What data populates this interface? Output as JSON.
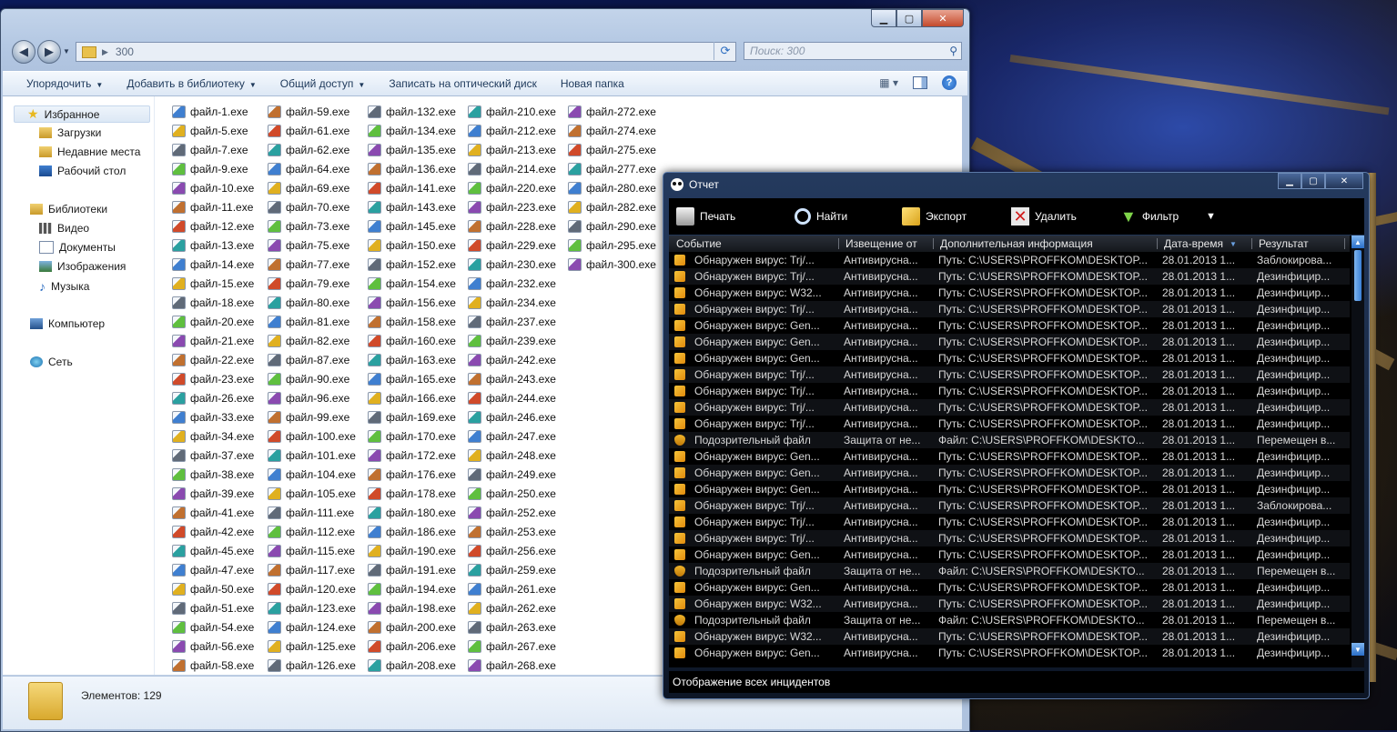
{
  "explorer": {
    "address_path": "300",
    "search_placeholder": "Поиск: 300",
    "toolbar": {
      "organize": "Упорядочить",
      "add_to_library": "Добавить в библиотеку",
      "share": "Общий доступ",
      "burn": "Записать на оптический диск",
      "new_folder": "Новая папка"
    },
    "nav": {
      "favorites": "Избранное",
      "downloads": "Загрузки",
      "recent": "Недавние места",
      "desktop": "Рабочий стол",
      "libraries": "Библиотеки",
      "video": "Видео",
      "documents": "Документы",
      "pictures": "Изображения",
      "music": "Музыка",
      "computer": "Компьютер",
      "network": "Сеть"
    },
    "columns": [
      [
        "файл-1.exe",
        "файл-5.exe",
        "файл-7.exe",
        "файл-9.exe",
        "файл-10.exe",
        "файл-11.exe",
        "файл-12.exe",
        "файл-13.exe",
        "файл-14.exe",
        "файл-15.exe",
        "файл-18.exe",
        "файл-20.exe",
        "файл-21.exe",
        "файл-22.exe",
        "файл-23.exe",
        "файл-26.exe",
        "файл-33.exe",
        "файл-34.exe",
        "файл-37.exe",
        "файл-38.exe",
        "файл-39.exe",
        "файл-41.exe",
        "файл-42.exe",
        "файл-45.exe",
        "файл-47.exe",
        "файл-50.exe",
        "файл-51.exe",
        "файл-54.exe",
        "файл-56.exe",
        "файл-58.exe"
      ],
      [
        "файл-59.exe",
        "файл-61.exe",
        "файл-62.exe",
        "файл-64.exe",
        "файл-69.exe",
        "файл-70.exe",
        "файл-73.exe",
        "файл-75.exe",
        "файл-77.exe",
        "файл-79.exe",
        "файл-80.exe",
        "файл-81.exe",
        "файл-82.exe",
        "файл-87.exe",
        "файл-90.exe",
        "файл-96.exe",
        "файл-99.exe",
        "файл-100.exe",
        "файл-101.exe",
        "файл-104.exe",
        "файл-105.exe",
        "файл-111.exe",
        "файл-112.exe",
        "файл-115.exe",
        "файл-117.exe",
        "файл-120.exe",
        "файл-123.exe",
        "файл-124.exe",
        "файл-125.exe",
        "файл-126.exe"
      ],
      [
        "файл-132.exe",
        "файл-134.exe",
        "файл-135.exe",
        "файл-136.exe",
        "файл-141.exe",
        "файл-143.exe",
        "файл-145.exe",
        "файл-150.exe",
        "файл-152.exe",
        "файл-154.exe",
        "файл-156.exe",
        "файл-158.exe",
        "файл-160.exe",
        "файл-163.exe",
        "файл-165.exe",
        "файл-166.exe",
        "файл-169.exe",
        "файл-170.exe",
        "файл-172.exe",
        "файл-176.exe",
        "файл-178.exe",
        "файл-180.exe",
        "файл-186.exe",
        "файл-190.exe",
        "файл-191.exe",
        "файл-194.exe",
        "файл-198.exe",
        "файл-200.exe",
        "файл-206.exe",
        "файл-208.exe"
      ],
      [
        "файл-210.exe",
        "файл-212.exe",
        "файл-213.exe",
        "файл-214.exe",
        "файл-220.exe",
        "файл-223.exe",
        "файл-228.exe",
        "файл-229.exe",
        "файл-230.exe",
        "файл-232.exe",
        "файл-234.exe",
        "файл-237.exe",
        "файл-239.exe",
        "файл-242.exe",
        "файл-243.exe",
        "файл-244.exe",
        "файл-246.exe",
        "файл-247.exe",
        "файл-248.exe",
        "файл-249.exe",
        "файл-250.exe",
        "файл-252.exe",
        "файл-253.exe",
        "файл-256.exe",
        "файл-259.exe",
        "файл-261.exe",
        "файл-262.exe",
        "файл-263.exe",
        "файл-267.exe",
        "файл-268.exe"
      ],
      [
        "файл-272.exe",
        "файл-274.exe",
        "файл-275.exe",
        "файл-277.exe",
        "файл-280.exe",
        "файл-282.exe",
        "файл-290.exe",
        "файл-295.exe",
        "файл-300.exe"
      ]
    ],
    "items_count": "Элементов: 129"
  },
  "report": {
    "title": "Отчет",
    "toolbar": {
      "print": "Печать",
      "find": "Найти",
      "export": "Экспорт",
      "delete": "Удалить",
      "filter": "Фильтр"
    },
    "headers": {
      "event": "Событие",
      "notified_by": "Извещение от",
      "info": "Дополнительная информация",
      "datetime": "Дата-время",
      "result": "Результат"
    },
    "rows": [
      {
        "event": "Обнаружен вирус: Trj/...",
        "from": "Антивирусна...",
        "info": "Путь: C:\\USERS\\PROFFKOM\\DESKTOP...",
        "date": "28.01.2013 1...",
        "result": "Заблокирова...",
        "icon": "virus"
      },
      {
        "event": "Обнаружен вирус: Trj/...",
        "from": "Антивирусна...",
        "info": "Путь: C:\\USERS\\PROFFKOM\\DESKTOP...",
        "date": "28.01.2013 1...",
        "result": "Дезинфицир...",
        "icon": "virus"
      },
      {
        "event": "Обнаружен вирус: W32...",
        "from": "Антивирусна...",
        "info": "Путь: C:\\USERS\\PROFFKOM\\DESKTOP...",
        "date": "28.01.2013 1...",
        "result": "Дезинфицир...",
        "icon": "virus"
      },
      {
        "event": "Обнаружен вирус: Trj/...",
        "from": "Антивирусна...",
        "info": "Путь: C:\\USERS\\PROFFKOM\\DESKTOP...",
        "date": "28.01.2013 1...",
        "result": "Дезинфицир...",
        "icon": "virus"
      },
      {
        "event": "Обнаружен вирус: Gen...",
        "from": "Антивирусна...",
        "info": "Путь: C:\\USERS\\PROFFKOM\\DESKTOP...",
        "date": "28.01.2013 1...",
        "result": "Дезинфицир...",
        "icon": "virus"
      },
      {
        "event": "Обнаружен вирус: Gen...",
        "from": "Антивирусна...",
        "info": "Путь: C:\\USERS\\PROFFKOM\\DESKTOP...",
        "date": "28.01.2013 1...",
        "result": "Дезинфицир...",
        "icon": "virus"
      },
      {
        "event": "Обнаружен вирус: Gen...",
        "from": "Антивирусна...",
        "info": "Путь: C:\\USERS\\PROFFKOM\\DESKTOP...",
        "date": "28.01.2013 1...",
        "result": "Дезинфицир...",
        "icon": "virus"
      },
      {
        "event": "Обнаружен вирус: Trj/...",
        "from": "Антивирусна...",
        "info": "Путь: C:\\USERS\\PROFFKOM\\DESKTOP...",
        "date": "28.01.2013 1...",
        "result": "Дезинфицир...",
        "icon": "virus"
      },
      {
        "event": "Обнаружен вирус: Trj/...",
        "from": "Антивирусна...",
        "info": "Путь: C:\\USERS\\PROFFKOM\\DESKTOP...",
        "date": "28.01.2013 1...",
        "result": "Дезинфицир...",
        "icon": "virus"
      },
      {
        "event": "Обнаружен вирус: Trj/...",
        "from": "Антивирусна...",
        "info": "Путь: C:\\USERS\\PROFFKOM\\DESKTOP...",
        "date": "28.01.2013 1...",
        "result": "Дезинфицир...",
        "icon": "virus"
      },
      {
        "event": "Обнаружен вирус: Trj/...",
        "from": "Антивирусна...",
        "info": "Путь: C:\\USERS\\PROFFKOM\\DESKTOP...",
        "date": "28.01.2013 1...",
        "result": "Дезинфицир...",
        "icon": "virus"
      },
      {
        "event": "Подозрительный файл",
        "from": "Защита от не...",
        "info": "Файл: C:\\USERS\\PROFFKOM\\DESKTO...",
        "date": "28.01.2013 1...",
        "result": "Перемещен в...",
        "icon": "shield"
      },
      {
        "event": "Обнаружен вирус: Gen...",
        "from": "Антивирусна...",
        "info": "Путь: C:\\USERS\\PROFFKOM\\DESKTOP...",
        "date": "28.01.2013 1...",
        "result": "Дезинфицир...",
        "icon": "virus"
      },
      {
        "event": "Обнаружен вирус: Gen...",
        "from": "Антивирусна...",
        "info": "Путь: C:\\USERS\\PROFFKOM\\DESKTOP...",
        "date": "28.01.2013 1...",
        "result": "Дезинфицир...",
        "icon": "virus"
      },
      {
        "event": "Обнаружен вирус: Gen...",
        "from": "Антивирусна...",
        "info": "Путь: C:\\USERS\\PROFFKOM\\DESKTOP...",
        "date": "28.01.2013 1...",
        "result": "Дезинфицир...",
        "icon": "virus"
      },
      {
        "event": "Обнаружен вирус: Trj/...",
        "from": "Антивирусна...",
        "info": "Путь: C:\\USERS\\PROFFKOM\\DESKTOP...",
        "date": "28.01.2013 1...",
        "result": "Заблокирова...",
        "icon": "virus"
      },
      {
        "event": "Обнаружен вирус: Trj/...",
        "from": "Антивирусна...",
        "info": "Путь: C:\\USERS\\PROFFKOM\\DESKTOP...",
        "date": "28.01.2013 1...",
        "result": "Дезинфицир...",
        "icon": "virus"
      },
      {
        "event": "Обнаружен вирус: Trj/...",
        "from": "Антивирусна...",
        "info": "Путь: C:\\USERS\\PROFFKOM\\DESKTOP...",
        "date": "28.01.2013 1...",
        "result": "Дезинфицир...",
        "icon": "virus"
      },
      {
        "event": "Обнаружен вирус: Gen...",
        "from": "Антивирусна...",
        "info": "Путь: C:\\USERS\\PROFFKOM\\DESKTOP...",
        "date": "28.01.2013 1...",
        "result": "Дезинфицир...",
        "icon": "virus"
      },
      {
        "event": "Подозрительный файл",
        "from": "Защита от не...",
        "info": "Файл: C:\\USERS\\PROFFKOM\\DESKTO...",
        "date": "28.01.2013 1...",
        "result": "Перемещен в...",
        "icon": "shield"
      },
      {
        "event": "Обнаружен вирус: Gen...",
        "from": "Антивирусна...",
        "info": "Путь: C:\\USERS\\PROFFKOM\\DESKTOP...",
        "date": "28.01.2013 1...",
        "result": "Дезинфицир...",
        "icon": "virus"
      },
      {
        "event": "Обнаружен вирус: W32...",
        "from": "Антивирусна...",
        "info": "Путь: C:\\USERS\\PROFFKOM\\DESKTOP...",
        "date": "28.01.2013 1...",
        "result": "Дезинфицир...",
        "icon": "virus"
      },
      {
        "event": "Подозрительный файл",
        "from": "Защита от не...",
        "info": "Файл: C:\\USERS\\PROFFKOM\\DESKTO...",
        "date": "28.01.2013 1...",
        "result": "Перемещен в...",
        "icon": "shield"
      },
      {
        "event": "Обнаружен вирус: W32...",
        "from": "Антивирусна...",
        "info": "Путь: C:\\USERS\\PROFFKOM\\DESKTOP...",
        "date": "28.01.2013 1...",
        "result": "Дезинфицир...",
        "icon": "virus"
      },
      {
        "event": "Обнаружен вирус: Gen...",
        "from": "Антивирусна...",
        "info": "Путь: C:\\USERS\\PROFFKOM\\DESKTOP...",
        "date": "28.01.2013 1...",
        "result": "Дезинфицир...",
        "icon": "virus"
      }
    ],
    "status": "Отображение всех инцидентов"
  }
}
